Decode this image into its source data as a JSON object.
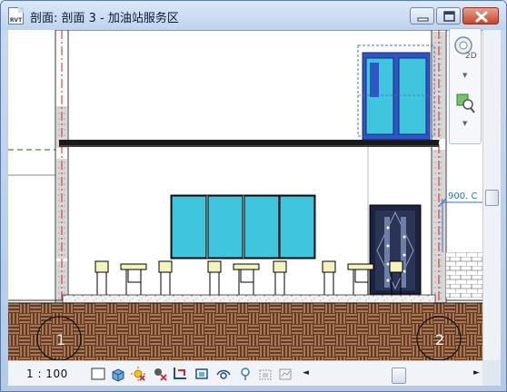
{
  "window": {
    "title": "剖面: 剖面 3 - 加油站服务区",
    "app_icon_text": "RVT"
  },
  "canvas": {
    "grid_bubbles": [
      {
        "label": "1"
      },
      {
        "label": "2"
      }
    ],
    "dimension_text": "900. C"
  },
  "navbar": {
    "wheel_label": "2D"
  },
  "bottom_toolbar": {
    "scale": "1 : 100",
    "icons": [
      "detail-level-icon",
      "visual-style-icon",
      "sun-path-icon",
      "shadows-icon",
      "crop-view-icon",
      "show-crop-region-icon",
      "temporary-hide-icon",
      "reveal-hidden-icon",
      "lightbulb-icon",
      "lock-3d-view-icon",
      "analysis-display-icon"
    ]
  },
  "colors": {
    "accent_blue": "#2f56c9",
    "glass": "#3fc6de",
    "earth": "#6b3a1e",
    "grid_line_red": "#d32020"
  }
}
